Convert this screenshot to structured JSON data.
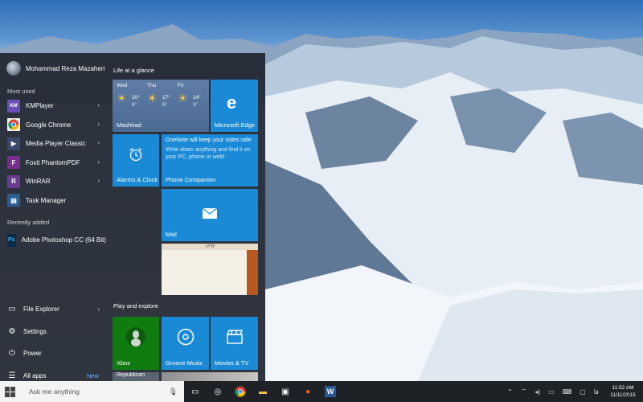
{
  "start_menu": {
    "user_name": "Mohammad Reza Mazaheri",
    "most_used_label": "Most used",
    "most_used": [
      {
        "label": "KMPlayer",
        "icon": "kmplayer-icon",
        "color": "#6a4fb8",
        "letter": "KM"
      },
      {
        "label": "Google Chrome",
        "icon": "chrome-icon",
        "color": "#f2f2f2",
        "letter": ""
      },
      {
        "label": "Media Player Classic",
        "icon": "media-player-icon",
        "color": "#3a4a6a",
        "letter": "▶"
      },
      {
        "label": "Foxit PhantomPDF",
        "icon": "foxit-icon",
        "color": "#7a2e8c",
        "letter": "F"
      },
      {
        "label": "WinRAR",
        "icon": "winrar-icon",
        "color": "#6b3b8f",
        "letter": "R"
      },
      {
        "label": "Task Manager",
        "icon": "task-manager-icon",
        "color": "#2b5e8f",
        "letter": "▤"
      }
    ],
    "recently_added_label": "Recently added",
    "recently_added": [
      {
        "label": "Adobe Photoshop CC (64 Bit)",
        "icon": "photoshop-icon",
        "color": "#0b2a4a",
        "letter": "Ps"
      }
    ],
    "bottom": {
      "file_explorer": "File Explorer",
      "settings": "Settings",
      "power": "Power",
      "all_apps": "All apps",
      "new_badge": "New"
    }
  },
  "tiles": {
    "group1_label": "Life at a glance",
    "group2_label": "Play and explore",
    "weather": {
      "location": "Mashhad",
      "days": [
        {
          "name": "Wed",
          "high": "20°",
          "low": "8°"
        },
        {
          "name": "Thu",
          "high": "17°",
          "low": "6°"
        },
        {
          "name": "Fri",
          "high": "14°",
          "low": "3°"
        }
      ]
    },
    "edge_label": "Microsoft Edge",
    "alarms_label": "Alarms & Clock",
    "phone": {
      "title": "OneNote will keep your notes safe",
      "body": "Write down anything and find it on your PC, phone or web!",
      "label": "Phone Companion"
    },
    "mail_label": "Mail",
    "calendar_header": "۱۳۹۴",
    "xbox_label": "Xbox",
    "groove_label": "Groove Music",
    "movies_label": "Movies & TV",
    "republican_label": "Republican"
  },
  "taskbar": {
    "search_placeholder": "Ask me anything",
    "time": "11:52 AM",
    "date": "11/11/2015",
    "lang": "فا"
  }
}
